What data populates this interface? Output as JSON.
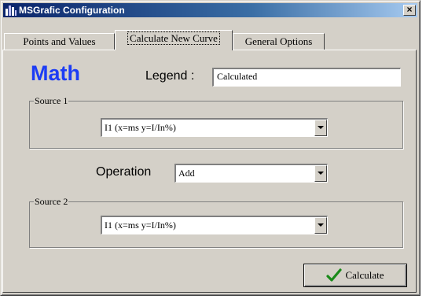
{
  "window": {
    "title": "MSGrafic Configuration",
    "close_label": "×"
  },
  "tabs": [
    {
      "label": "Points and Values",
      "active": false
    },
    {
      "label": "Calculate New Curve",
      "active": true
    },
    {
      "label": "General Options",
      "active": false
    }
  ],
  "math": {
    "heading": "Math",
    "legend_label": "Legend :",
    "legend_value": "Calculated",
    "source1": {
      "label": "Source 1",
      "selected": "I1 (x=ms y=I/In%)"
    },
    "operation": {
      "label": "Operation",
      "selected": "Add"
    },
    "source2": {
      "label": "Source 2",
      "selected": "I1 (x=ms y=I/In%)"
    },
    "calculate_label": "Calculate"
  },
  "colors": {
    "accent": "#1c3cf5",
    "titlebar": "#0a246a",
    "check": "#1a8a1a"
  }
}
